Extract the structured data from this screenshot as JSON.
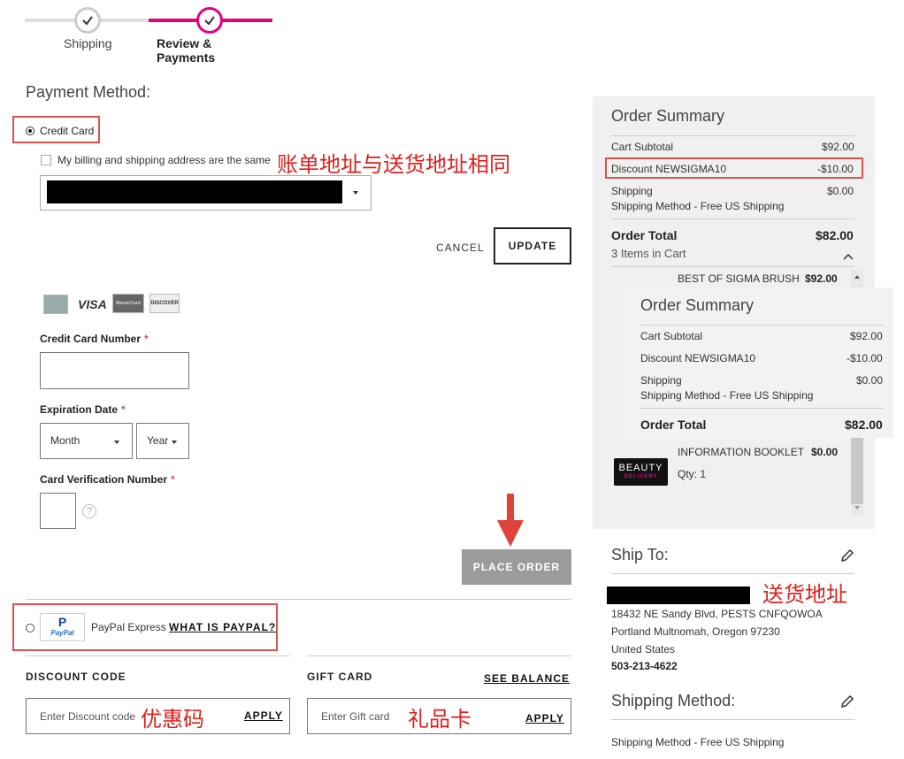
{
  "progress": {
    "steps": [
      {
        "label": "Shipping"
      },
      {
        "label": "Review & Payments"
      }
    ],
    "accent": "#e6007e"
  },
  "payment": {
    "title": "Payment Method:",
    "credit_card_label": "Credit Card",
    "billing_same_label": "My billing and shipping address are the same",
    "cancel_label": "CANCEL",
    "update_label": "UPDATE",
    "card_logos": [
      "VISA",
      "MasterCard",
      "DISCOVER"
    ],
    "card_number_label": "Credit Card Number",
    "required_mark": "*",
    "expiration_label": "Expiration Date",
    "month_label": "Month",
    "year_label": "Year",
    "cvv_label": "Card Verification Number",
    "help_glyph": "?",
    "place_order_label": "PLACE ORDER",
    "paypal_label": "PayPal Express",
    "paypal_logo_text": "PayPal",
    "what_is_paypal": "WHAT IS PAYPAL?"
  },
  "discount": {
    "title": "DISCOUNT CODE",
    "placeholder": "Enter Discount code",
    "apply_label": "APPLY"
  },
  "giftcard": {
    "title": "GIFT CARD",
    "see_balance": "SEE BALANCE",
    "placeholder": "Enter Gift card",
    "apply_label": "APPLY"
  },
  "annotations": {
    "billing": "账单地址与送货地址相同",
    "ship_addr": "送货地址",
    "discount": "优惠码",
    "gift": "礼品卡"
  },
  "summary": {
    "title": "Order Summary",
    "cart_subtotal_label": "Cart Subtotal",
    "cart_subtotal": "$92.00",
    "discount_label": "Discount NEWSIGMA10",
    "discount_value": "-$10.00",
    "shipping_label": "Shipping",
    "shipping_value": "$0.00",
    "shipping_method": "Shipping Method - Free US Shipping",
    "order_total_label": "Order Total",
    "order_total": "$82.00",
    "items_in_cart": "3 Items in Cart",
    "item1_name": "BEST OF SIGMA BRUSH",
    "item1_price": "$92.00",
    "item2_name": "INFORMATION BOOKLET",
    "item2_price": "$0.00",
    "item2_qty": "Qty: 1",
    "beauty_logo_line1": "BEAUTY",
    "beauty_logo_line2": "DELIVERY"
  },
  "ship_to": {
    "title": "Ship To:",
    "line1": "18432 NE Sandy Blvd, PESTS CNFQOWOA",
    "line2": "Portland Multnomah, Oregon 97230",
    "line3": "United States",
    "phone": "503-213-4622"
  },
  "shipping_method": {
    "title": "Shipping Method:",
    "value": "Shipping Method - Free US Shipping"
  }
}
